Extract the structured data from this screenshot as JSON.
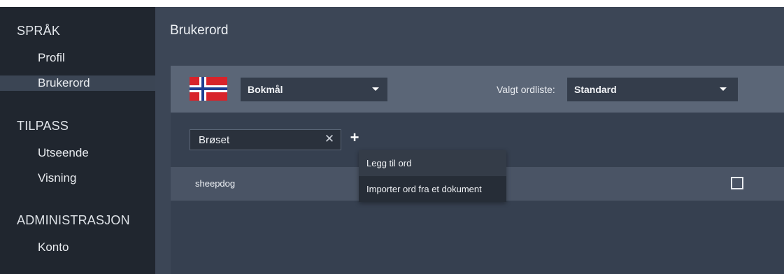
{
  "sidebar": {
    "sections": [
      {
        "title": "SPRÅK",
        "items": [
          {
            "label": "Profil",
            "active": false
          },
          {
            "label": "Brukerord",
            "active": true
          }
        ]
      },
      {
        "title": "TILPASS",
        "items": [
          {
            "label": "Utseende",
            "active": false
          },
          {
            "label": "Visning",
            "active": false
          }
        ]
      },
      {
        "title": "ADMINISTRASJON",
        "items": [
          {
            "label": "Konto",
            "active": false
          }
        ]
      }
    ]
  },
  "main": {
    "title": "Brukerord",
    "language": {
      "flag": "norway-flag-icon",
      "selected": "Bokmål"
    },
    "wordlist": {
      "label": "Valgt ordliste:",
      "selected": "Standard"
    },
    "input": {
      "value": "Brøset"
    },
    "add_menu": {
      "items": [
        "Legg til ord",
        "Importer ord fra et dokument"
      ]
    },
    "words": [
      {
        "text": "sheepdog",
        "checked": false
      }
    ]
  },
  "colors": {
    "sidebar_bg": "#20262f",
    "sidebar_active": "#3b4554",
    "main_bg": "#3c4656",
    "panel_bg": "#364050",
    "lang_bar_bg": "#5b6677",
    "row_bg": "#4a5465",
    "menu_bg": "#262d37"
  }
}
